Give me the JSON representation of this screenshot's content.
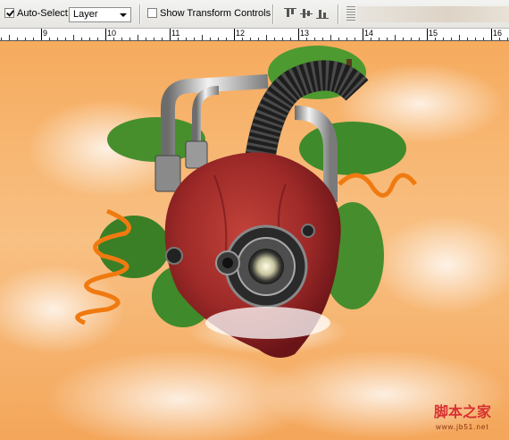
{
  "options_bar": {
    "auto_select_checked": true,
    "auto_select_label": "Auto-Select:",
    "auto_select_target": "Layer",
    "show_transform_checked": false,
    "show_transform_label": "Show Transform Controls",
    "align_icons": [
      "align-top-edges-icon",
      "align-vertical-centers-icon",
      "align-bottom-edges-icon"
    ]
  },
  "ruler": {
    "ticks": [
      "9",
      "10",
      "11",
      "12",
      "13",
      "14",
      "15",
      "16"
    ]
  },
  "canvas": {
    "artwork": "mechanical-heart-illustration",
    "background_colors": [
      "#f6b26b",
      "#fbe3c4",
      "#ffffff"
    ]
  },
  "watermark": {
    "text": "脚本之家",
    "url": "www.jb51.net"
  }
}
